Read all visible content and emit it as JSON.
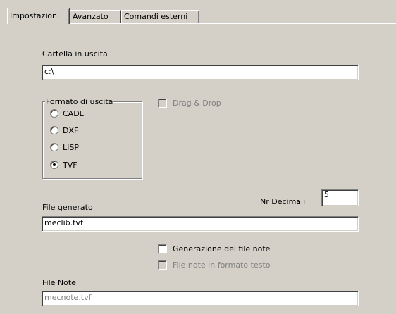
{
  "tabs": [
    {
      "label": "Impostazioni",
      "active": true
    },
    {
      "label": "Avanzato",
      "active": false
    },
    {
      "label": "Comandi esterni",
      "active": false
    }
  ],
  "output_folder": {
    "label": "Cartella in uscita",
    "value": "c:\\"
  },
  "output_format": {
    "title": "Formato di uscita",
    "options": [
      {
        "label": "CADL",
        "checked": false
      },
      {
        "label": "DXF",
        "checked": false
      },
      {
        "label": "LISP",
        "checked": false
      },
      {
        "label": "TVF",
        "checked": true
      }
    ]
  },
  "drag_drop": {
    "label": "Drag & Drop",
    "checked": false,
    "enabled": false
  },
  "decimals": {
    "label": "Nr Decimali",
    "value": "5"
  },
  "generated_file": {
    "label": "File generato",
    "value": "meclib.tvf"
  },
  "note_generation": {
    "label": "Generazione del file note",
    "checked": false,
    "enabled": true
  },
  "note_text_format": {
    "label": "File note in formato testo",
    "checked": false,
    "enabled": false
  },
  "note_file": {
    "label": "File Note",
    "value": "mecnote.tvf",
    "enabled": false
  }
}
